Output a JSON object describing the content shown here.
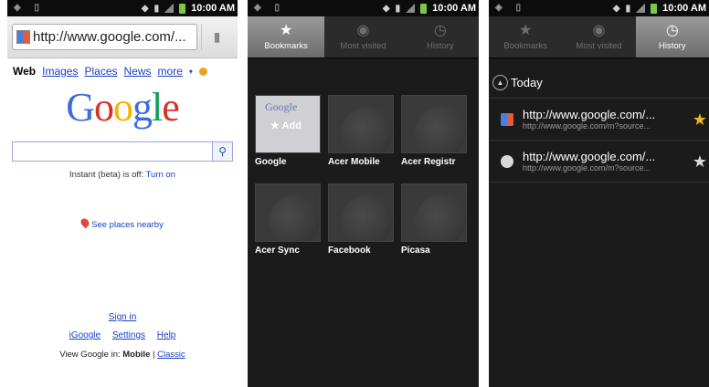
{
  "status": {
    "time": "10:00 AM"
  },
  "browser": {
    "url": "http://www.google.com/...",
    "nav": [
      "Web",
      "Images",
      "Places",
      "News",
      "more"
    ],
    "logo": "Google",
    "instant_text": "Instant (beta) is off:",
    "instant_link": "Turn on",
    "places": "See places nearby",
    "signin": "Sign in",
    "links": [
      "iGoogle",
      "Settings",
      "Help"
    ],
    "view_prefix": "View Google in:",
    "view_mobile": "Mobile",
    "view_sep": "|",
    "view_classic": "Classic"
  },
  "tabs": [
    "Bookmarks",
    "Most visited",
    "History"
  ],
  "bookmarks": [
    {
      "label": "Google",
      "add": "Add"
    },
    {
      "label": "Acer Mobile"
    },
    {
      "label": "Acer Registr"
    },
    {
      "label": "Acer Sync"
    },
    {
      "label": "Facebook"
    },
    {
      "label": "Picasa"
    }
  ],
  "history": {
    "group": "Today",
    "items": [
      {
        "title": "http://www.google.com/...",
        "url": "http://www.google.com/m?source...",
        "starred": true
      },
      {
        "title": "http://www.google.com/...",
        "url": "http://www.google.com/m?source...",
        "starred": false
      }
    ]
  },
  "colors": {
    "link": "#1a3fc7",
    "star_on": "#f0b429",
    "star_off": "#d8d8d8"
  }
}
